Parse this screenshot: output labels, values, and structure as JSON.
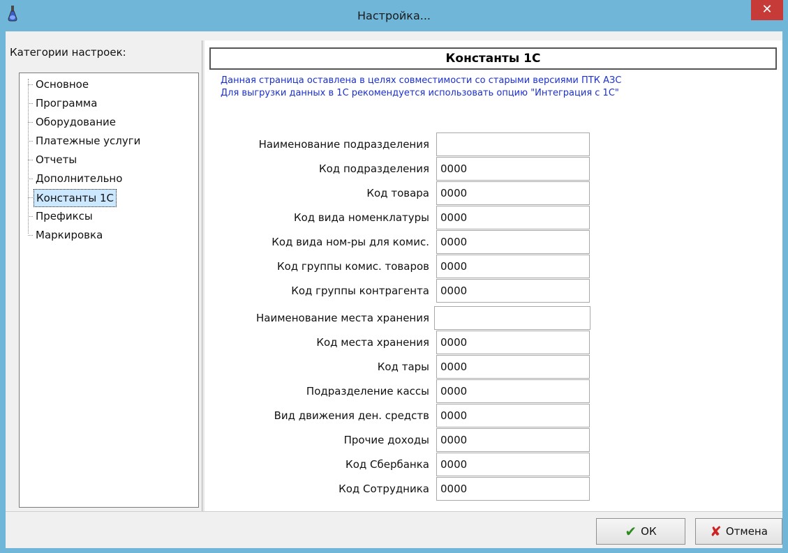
{
  "window": {
    "title": "Настройка..."
  },
  "left": {
    "label": "Категории настроек:",
    "items": [
      {
        "label": "Основное"
      },
      {
        "label": "Программа"
      },
      {
        "label": "Оборудование"
      },
      {
        "label": "Платежные услуги"
      },
      {
        "label": "Отчеты"
      },
      {
        "label": "Дополнительно"
      },
      {
        "label": "Константы 1С",
        "selected": true
      },
      {
        "label": "Префиксы"
      },
      {
        "label": "Маркировка"
      }
    ]
  },
  "main": {
    "header": "Константы 1С",
    "notice": [
      "Данная страница оставлена в целях совместимости со старыми версиями ПТК АЗС",
      "Для выгрузки данных в 1С рекомендуется использовать опцию \"Интеграция с 1С\""
    ],
    "fields": [
      {
        "label": "Наименование подразделения",
        "value": ""
      },
      {
        "label": "Код подразделения",
        "value": "0000"
      },
      {
        "label": "Код товара",
        "value": "0000"
      },
      {
        "label": "Код вида номенклатуры",
        "value": "0000"
      },
      {
        "label": "Код вида ном-ры для комис.",
        "value": "0000"
      },
      {
        "label": "Код группы комис. товаров",
        "value": "0000"
      },
      {
        "label": "Код группы контрагента",
        "value": "0000"
      },
      {
        "label": "Наименование места хранения",
        "value": ""
      },
      {
        "label": "Код места хранения",
        "value": "0000"
      },
      {
        "label": "Код тары",
        "value": "0000"
      },
      {
        "label": "Подразделение кассы",
        "value": "0000"
      },
      {
        "label": "Вид движения ден. средств",
        "value": "0000"
      },
      {
        "label": "Прочие доходы",
        "value": "0000"
      },
      {
        "label": "Код Сбербанка",
        "value": "0000"
      },
      {
        "label": "Код Сотрудника",
        "value": "0000"
      }
    ]
  },
  "footer": {
    "ok_label": "ОК",
    "cancel_label": "Отмена"
  },
  "icons": {
    "app": "flask-icon",
    "close": "close-icon",
    "ok": "checkmark-icon",
    "cancel": "cross-icon"
  },
  "colors": {
    "titlebar": "#6fb6d9",
    "close": "#c63a37",
    "notice": "#1a2fd0"
  }
}
